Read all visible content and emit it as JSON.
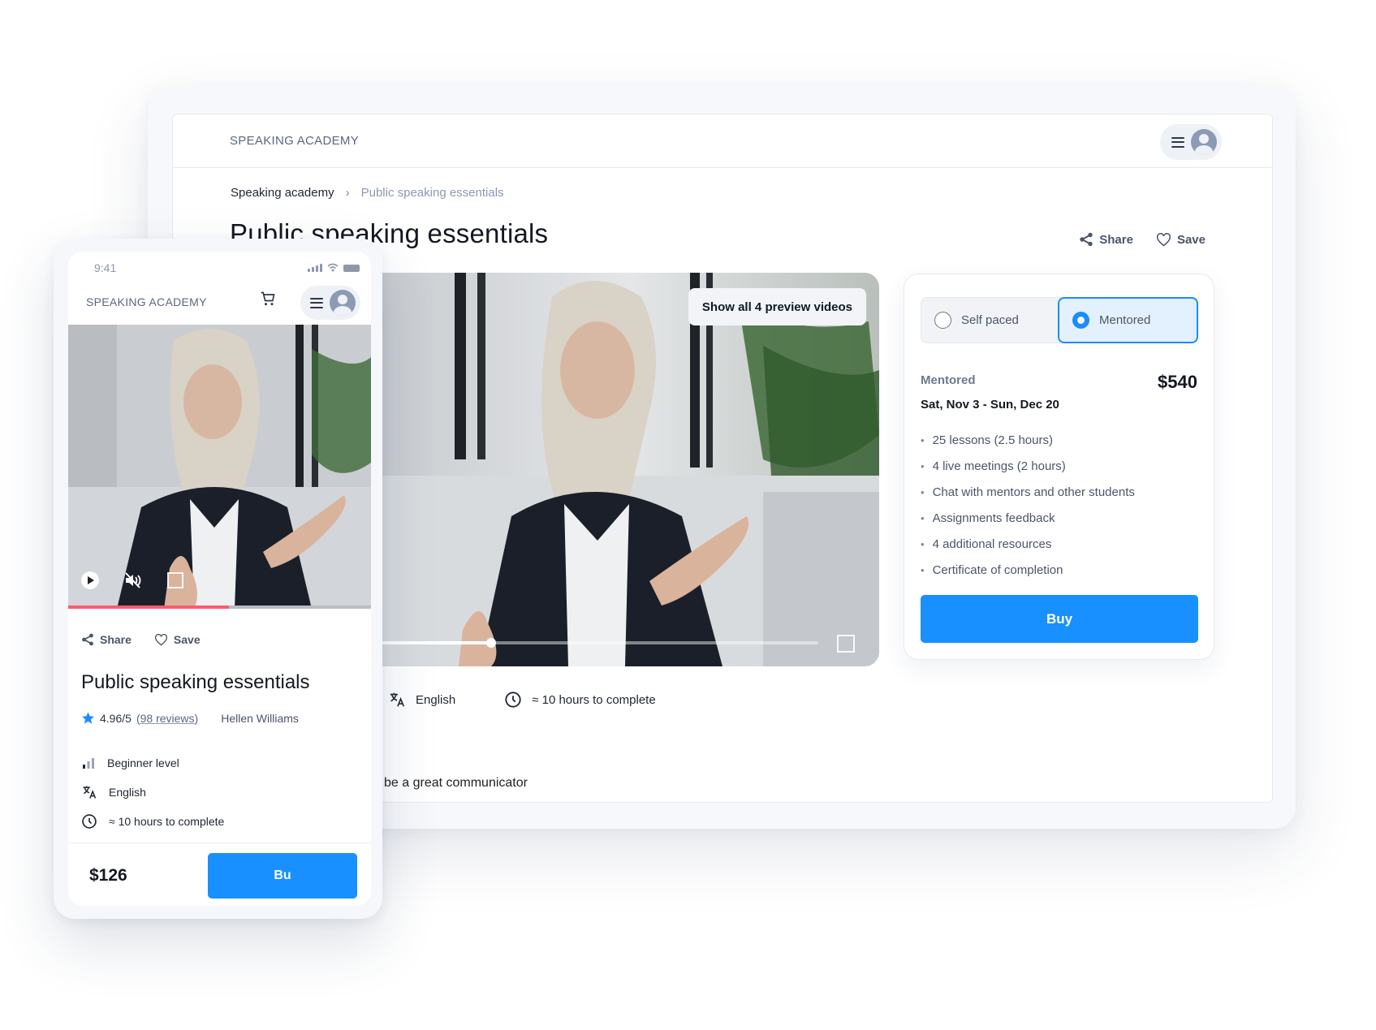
{
  "desktop": {
    "brand": "SPEAKING ACADEMY",
    "breadcrumb": {
      "parent": "Speaking academy",
      "separator": "›",
      "current": "Public speaking essentials"
    },
    "title": "Public speaking essentials",
    "actions": {
      "share": "Share",
      "save": "Save"
    },
    "video": {
      "preview_button": "Show all 4 preview videos",
      "progress": 0.25
    },
    "meta": {
      "language": "English",
      "duration": "≈ 10 hours to complete"
    },
    "description_partial": "be a great communicator",
    "pricing": {
      "options": [
        {
          "label": "Self paced",
          "selected": false
        },
        {
          "label": "Mentored",
          "selected": true
        }
      ],
      "plan_label": "Mentored",
      "price": "$540",
      "dates": "Sat, Nov 3 - Sun, Dec 20",
      "features": [
        "25 lessons (2.5 hours)",
        "4 live meetings (2 hours)",
        "Chat with mentors and other students",
        "Assignments feedback",
        "4 additional resources",
        "Certificate of completion"
      ],
      "buy_label": "Buy"
    }
  },
  "mobile": {
    "time": "9:41",
    "brand": "SPEAKING ACADEMY",
    "video": {
      "progress": 0.53
    },
    "actions": {
      "share": "Share",
      "save": "Save"
    },
    "title": "Public speaking essentials",
    "rating": "4.96/5",
    "reviews_open": "(",
    "reviews": "98 reviews",
    "reviews_close": ")",
    "author": "Hellen Williams",
    "meta": {
      "level": "Beginner level",
      "language": "English",
      "duration": "≈ 10 hours to complete"
    },
    "price": "$126",
    "buy_label": "Bu"
  },
  "colors": {
    "accent": "#1890ff",
    "mobile_progress": "#ff5a6e",
    "star": "#1a8cff"
  }
}
